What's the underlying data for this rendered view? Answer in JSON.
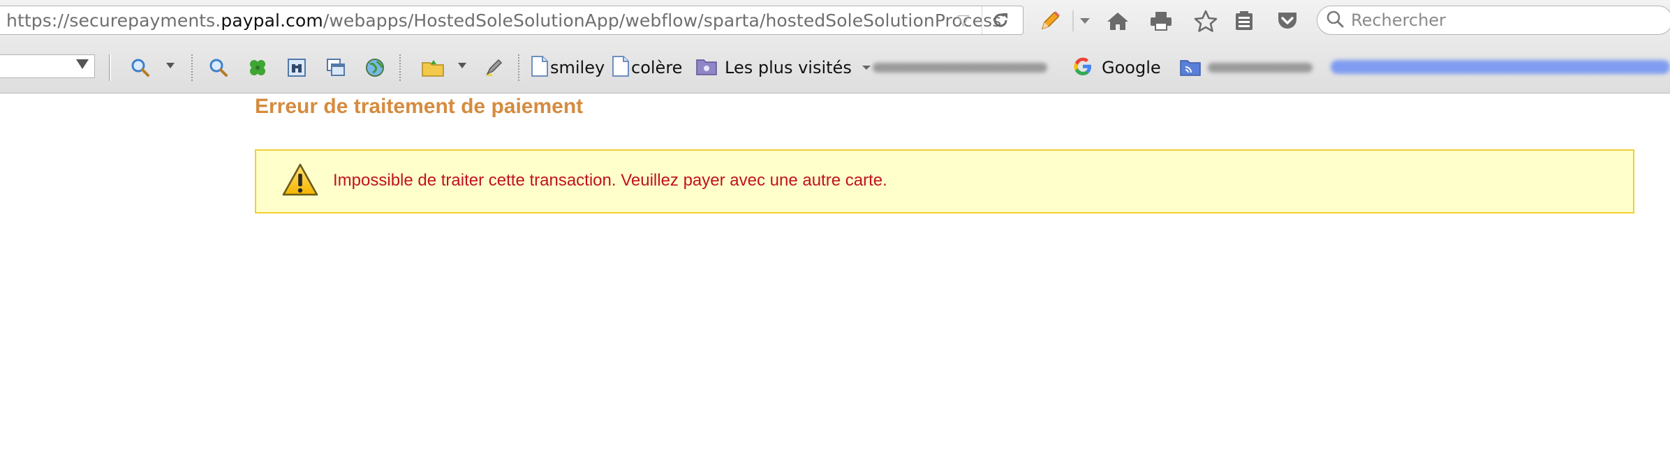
{
  "browser": {
    "url": {
      "prefix": "https://securepayments.",
      "domain": "paypal.com",
      "path": "/webapps/HostedSoleSolutionApp/webflow/sparta/hostedSoleSolutionProcess"
    },
    "search": {
      "placeholder": "Rechercher"
    },
    "nav_icons": [
      "pencil-icon",
      "home-icon",
      "print-icon",
      "star-icon",
      "reading-list-icon",
      "pocket-icon"
    ],
    "bookmarks": [
      {
        "label": "smiley",
        "icon": "page-icon"
      },
      {
        "label": "colère",
        "icon": "page-icon"
      },
      {
        "label": "Les plus visités",
        "icon": "folder-icon"
      },
      {
        "label": "Google",
        "icon": "google-icon"
      }
    ]
  },
  "page": {
    "title": "Erreur de traitement de paiement",
    "alert": {
      "message": "Impossible de traiter cette transaction. Veuillez payer avec une autre carte.",
      "icon": "warning-icon"
    }
  },
  "colors": {
    "title": "#d58b3e",
    "alert_bg": "#ffffcc",
    "alert_border": "#f2cf32",
    "alert_text": "#c1121f"
  }
}
